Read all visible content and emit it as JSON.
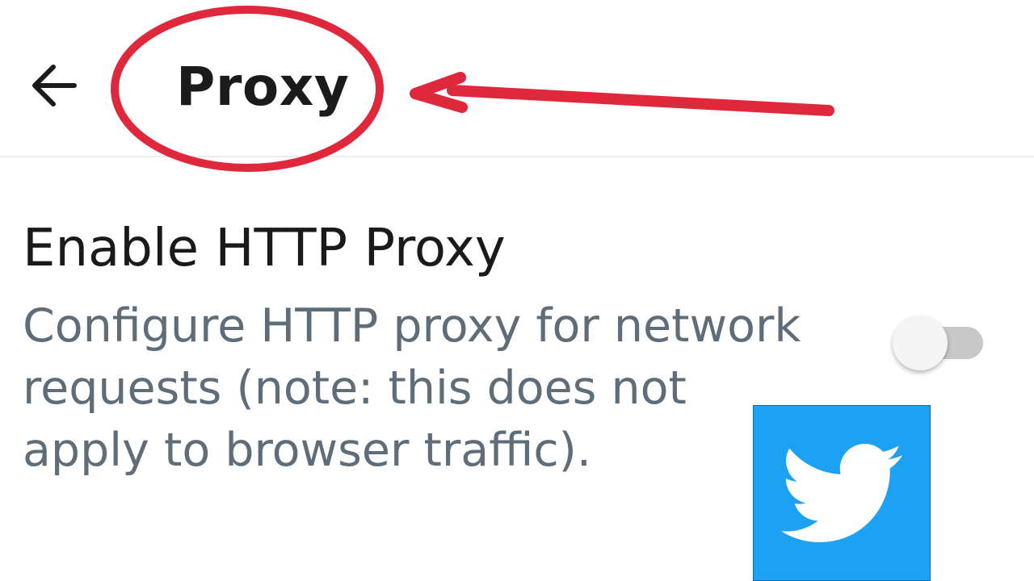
{
  "header": {
    "title": "Proxy",
    "back_icon": "arrow-left-icon"
  },
  "setting": {
    "title": "Enable HTTP Proxy",
    "description_lines": [
      "Configure HTTP proxy for network",
      "requests (note: this does not",
      "apply to browser traffic)."
    ],
    "enabled": false
  },
  "overlay": {
    "annotation_color": "#e0283c",
    "logo": "twitter-bird-icon",
    "logo_color": "#1da1f2"
  }
}
